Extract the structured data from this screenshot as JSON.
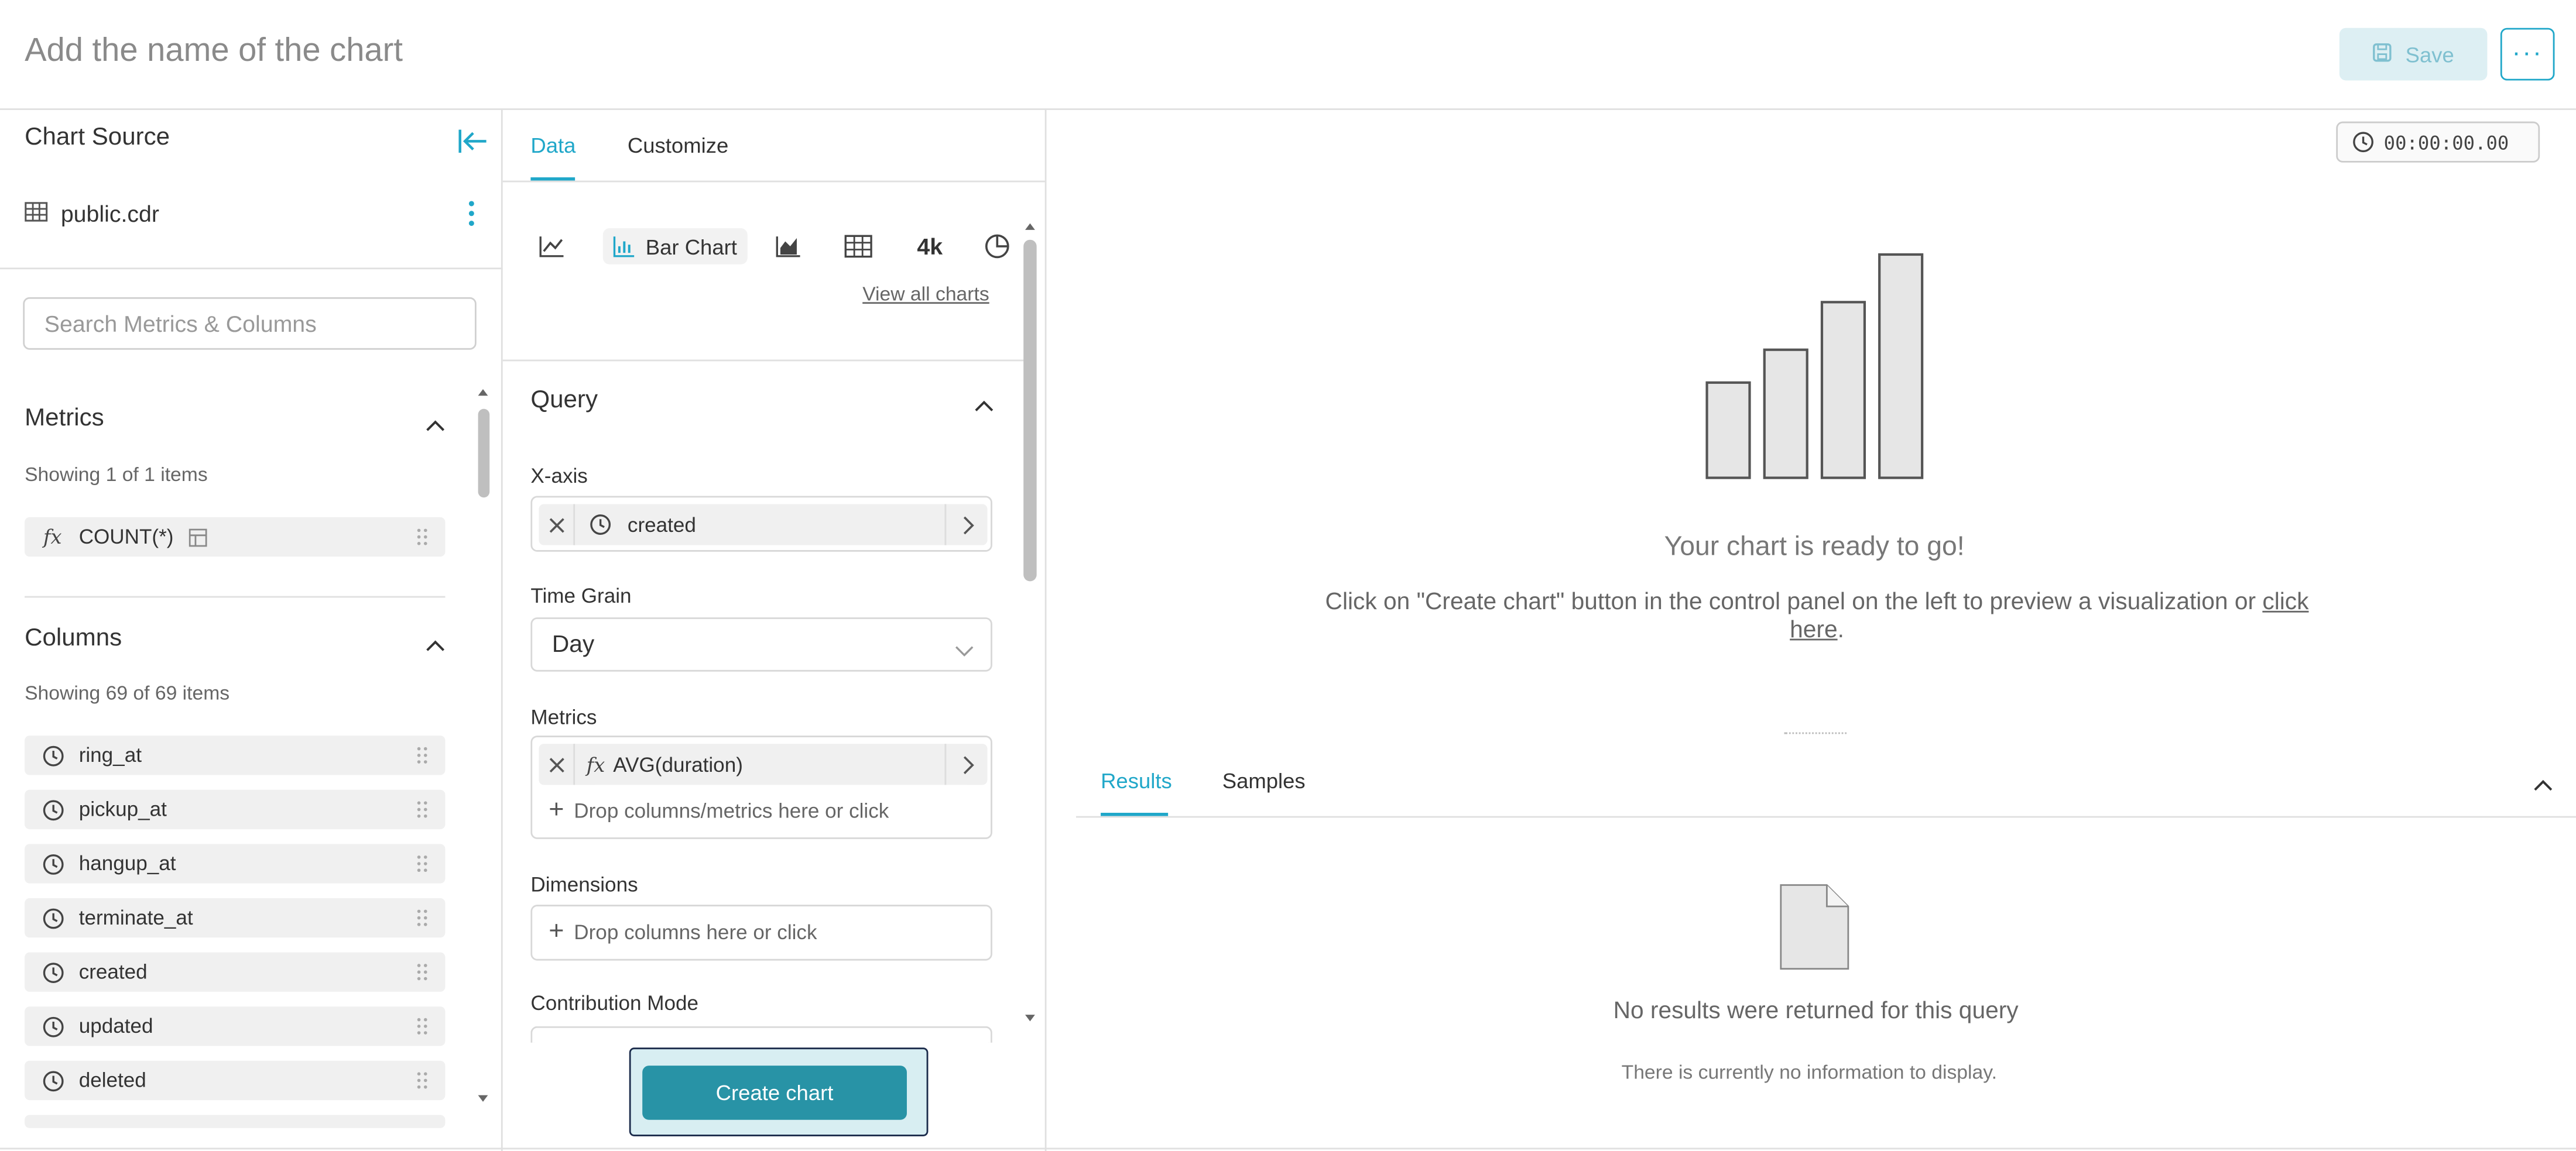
{
  "header": {
    "chart_name_placeholder": "Add the name of the chart",
    "save_label": "Save",
    "more_label": "···"
  },
  "left_panel": {
    "source_title": "Chart Source",
    "dataset_name": "public.cdr",
    "search_placeholder": "Search Metrics & Columns",
    "metrics": {
      "title": "Metrics",
      "showing": "Showing 1 of 1 items",
      "items": [
        {
          "fx": "fx",
          "label": "COUNT(*)"
        }
      ]
    },
    "columns": {
      "title": "Columns",
      "showing": "Showing 69 of 69 items",
      "items": [
        {
          "label": "ring_at"
        },
        {
          "label": "pickup_at"
        },
        {
          "label": "hangup_at"
        },
        {
          "label": "terminate_at"
        },
        {
          "label": "created"
        },
        {
          "label": "updated"
        },
        {
          "label": "deleted"
        }
      ]
    }
  },
  "middle_panel": {
    "tabs": [
      {
        "label": "Data"
      },
      {
        "label": "Customize"
      }
    ],
    "active_viz_label": "Bar Chart",
    "big_number_label": "4k",
    "view_all_charts": "View all charts",
    "query": {
      "title": "Query",
      "x_axis_label": "X-axis",
      "x_axis_value": "created",
      "time_grain_label": "Time Grain",
      "time_grain_value": "Day",
      "metrics_label": "Metrics",
      "metric_fx": "fx",
      "metric_value": "AVG(duration)",
      "metrics_drop_hint": "Drop columns/metrics here or click",
      "dimensions_label": "Dimensions",
      "dimensions_drop_hint": "Drop columns here or click",
      "contribution_label": "Contribution Mode"
    },
    "create_chart_label": "Create chart"
  },
  "right_panel": {
    "timer": "00:00:00.00",
    "ready_title": "Your chart is ready to go!",
    "ready_desc_prefix": "Click on \"Create chart\" button in the control panel on the left to preview a visualization or ",
    "ready_desc_link": "click here",
    "ready_desc_suffix": ".",
    "tabs": [
      {
        "label": "Results"
      },
      {
        "label": "Samples"
      }
    ],
    "no_results": "No results were returned for this query",
    "no_info": "There is currently no information to display."
  },
  "colors": {
    "accent": "#20A7C9",
    "create_button": "#2893A6",
    "chip_bg": "#F0F0F0"
  }
}
